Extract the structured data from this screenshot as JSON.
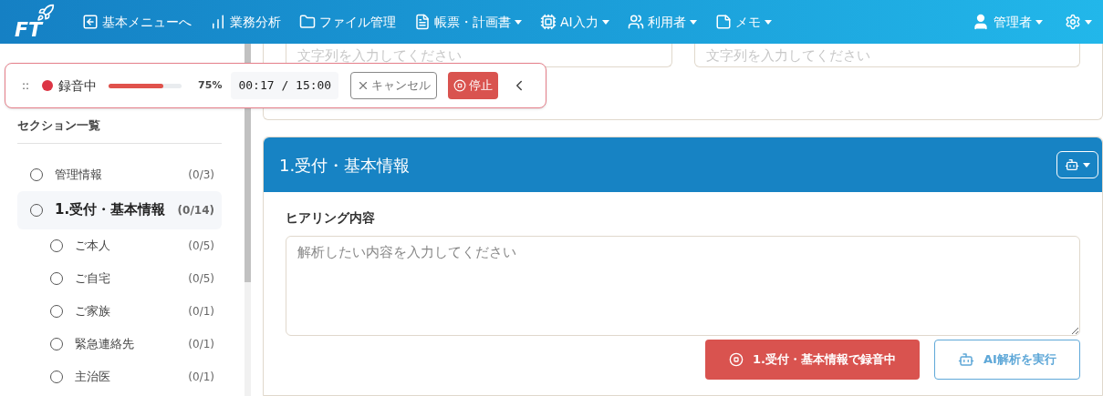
{
  "header": {
    "logo": "FT",
    "nav": [
      {
        "label": "基本メニューへ",
        "dropdown": false
      },
      {
        "label": "業務分析",
        "dropdown": false
      },
      {
        "label": "ファイル管理",
        "dropdown": false
      },
      {
        "label": "帳票・計画書",
        "dropdown": true
      },
      {
        "label": "AI入力",
        "dropdown": true
      },
      {
        "label": "利用者",
        "dropdown": true
      },
      {
        "label": "メモ",
        "dropdown": true
      }
    ],
    "user": {
      "label": "管理者",
      "dropdown": true
    },
    "settings": {
      "dropdown": true
    }
  },
  "recorder": {
    "handle": "::",
    "status": "録音中",
    "level": 0.75,
    "percent": "75%",
    "time": "00:17 / 15:00",
    "cancel": "キャンセル",
    "stop": "停止"
  },
  "sidebar": {
    "title": "セクション一覧",
    "items": [
      {
        "label": "管理情報",
        "count": "(0/3)",
        "selected": false
      },
      {
        "label": "1.受付・基本情報",
        "count": "(0/14)",
        "selected": true,
        "children": [
          {
            "label": "ご本人",
            "count": "(0/5)",
            "selected": false
          },
          {
            "label": "ご自宅",
            "count": "(0/5)",
            "selected": false
          },
          {
            "label": "ご家族",
            "count": "(0/1)",
            "selected": false
          },
          {
            "label": "緊急連絡先",
            "count": "(0/1)",
            "selected": false
          },
          {
            "label": "主治医",
            "count": "(0/1)",
            "selected": false
          }
        ]
      }
    ]
  },
  "top_card": {
    "fields": [
      {
        "placeholder": "文字列を入力してください"
      },
      {
        "placeholder": "文字列を入力してください"
      }
    ]
  },
  "section": {
    "title": "1.受付・基本情報",
    "field_label": "ヒアリング内容",
    "placeholder": "解析したい内容を入力してください",
    "record_button": "1.受付・基本情報で録音中",
    "recording": true,
    "ai_button": "AI解析を実行"
  }
}
